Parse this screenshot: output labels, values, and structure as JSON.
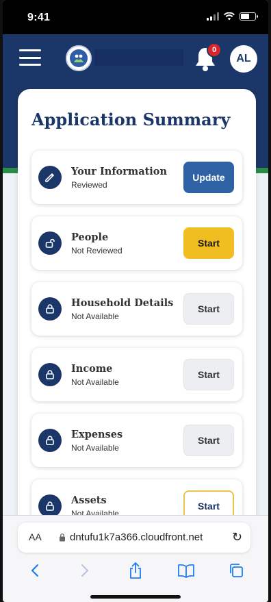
{
  "status_bar": {
    "time": "9:41"
  },
  "header": {
    "notification_count": "0",
    "avatar_initials": "AL"
  },
  "page": {
    "title": "Application Summary"
  },
  "items": [
    {
      "name": "Your Information",
      "status": "Reviewed",
      "button": "Update",
      "icon": "pencil-icon",
      "button_style": "update"
    },
    {
      "name": "People",
      "status": "Not Reviewed",
      "button": "Start",
      "icon": "unlock-icon",
      "button_style": "yellow"
    },
    {
      "name": "Household Details",
      "status": "Not Available",
      "button": "Start",
      "icon": "lock-icon",
      "button_style": "gray"
    },
    {
      "name": "Income",
      "status": "Not Available",
      "button": "Start",
      "icon": "lock-icon",
      "button_style": "gray"
    },
    {
      "name": "Expenses",
      "status": "Not Available",
      "button": "Start",
      "icon": "lock-icon",
      "button_style": "gray"
    },
    {
      "name": "Assets",
      "status": "Not Available",
      "button": "Start",
      "icon": "lock-icon",
      "button_style": "outlined"
    }
  ],
  "browser": {
    "text_size_label": "AA",
    "url": "dntufu1k7a366.cloudfront.net"
  },
  "colors": {
    "header": "#1b3668",
    "accent_green": "#2c8c4a",
    "update_button": "#2e62a4",
    "start_yellow": "#f1be22",
    "badge_red": "#d9262c"
  }
}
